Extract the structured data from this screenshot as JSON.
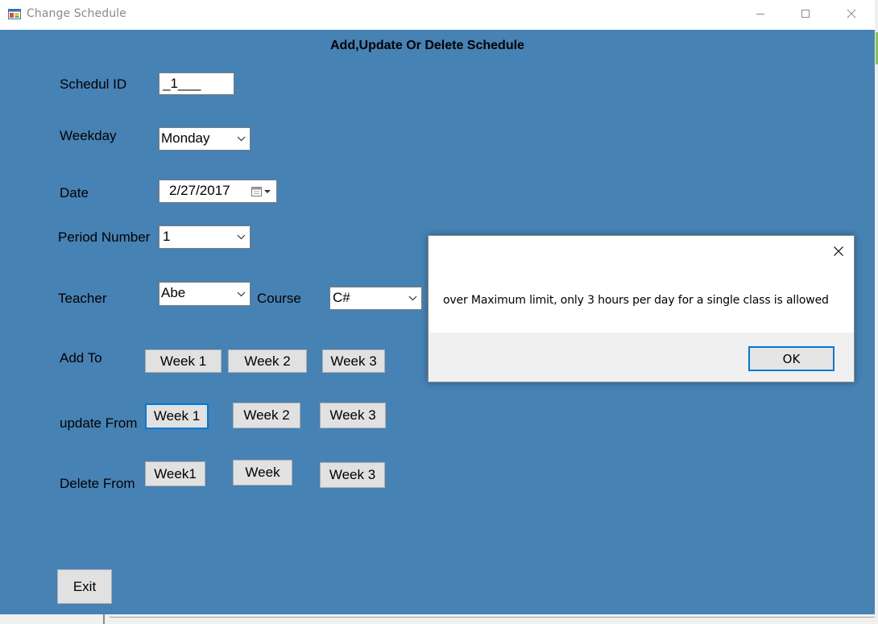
{
  "window": {
    "title": "Change Schedule",
    "controls": [
      "minimize-icon",
      "maximize-icon",
      "close-icon"
    ]
  },
  "form": {
    "heading": "Add,Update Or Delete Schedule",
    "labels": {
      "schedule_id": "Schedul ID",
      "weekday": "Weekday",
      "date": "Date",
      "period": "Period Number",
      "teacher": "Teacher",
      "course": "Course",
      "add_to": "Add To",
      "update_from": "update From",
      "delete_from": "Delete From"
    },
    "values": {
      "schedule_id": "_1___",
      "weekday": "Monday",
      "date": "2/27/2017",
      "period": "1",
      "teacher": "Abe",
      "course": "C#"
    },
    "add_buttons": [
      "Week 1",
      "Week 2",
      "Week 3"
    ],
    "update_buttons": [
      "Week 1",
      "Week 2",
      "Week 3"
    ],
    "delete_buttons": [
      "Week1",
      "Week",
      "Week 3"
    ],
    "exit_label": "Exit"
  },
  "dialog": {
    "message": "over Maximum limit,  only 3 hours per day for a single class is allowed",
    "ok_label": "OK"
  },
  "colors": {
    "client_background": "#4682b4",
    "focus_border": "#0078d7",
    "button_face": "#e1e1e1"
  }
}
